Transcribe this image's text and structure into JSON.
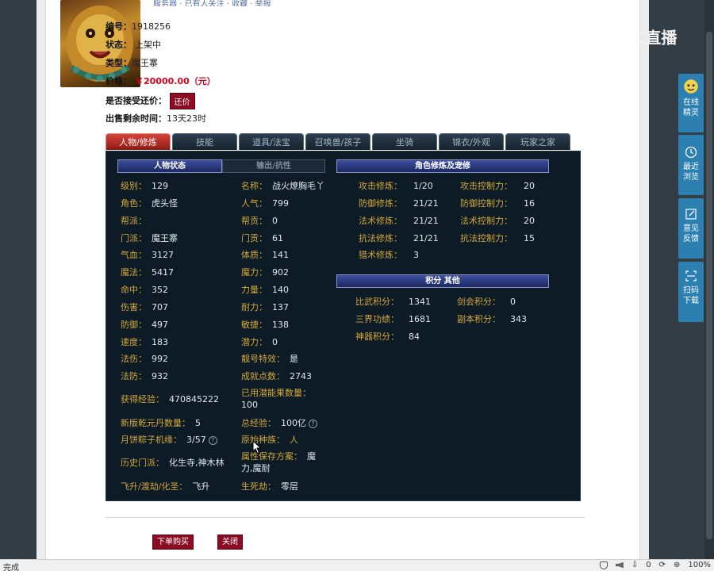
{
  "logo": "CC直播",
  "top_links": "服务器 · 已有人关注 · 收藏 · 举报",
  "info": {
    "number_label": "编号：",
    "number": "1918256",
    "status_label": "状态：",
    "status": "上架中",
    "type_label": "类型：",
    "type": "魔王寨",
    "price_label": "价格：",
    "price": "￥20000.00（元）",
    "bargain_label": "是否接受还价：",
    "bargain_button": "还价",
    "remaining_label": "出售剩余时间：",
    "remaining": "13天23时"
  },
  "tabs": [
    "人物/修炼",
    "技能",
    "道具/法宝",
    "召唤兽/孩子",
    "坐骑",
    "锦衣/外观",
    "玩家之家"
  ],
  "status_tabs": {
    "active": "人物状态",
    "inactive": "输出/抗性"
  },
  "left_col": [
    {
      "k": "级别：",
      "v": "129"
    },
    {
      "k": "角色：",
      "v": "虎头怪"
    },
    {
      "k": "帮派：",
      "v": ""
    },
    {
      "k": "门派：",
      "v": "魔王寨"
    },
    {
      "k": "气血：",
      "v": "3127"
    },
    {
      "k": "魔法：",
      "v": "5417"
    },
    {
      "k": "命中：",
      "v": "352"
    },
    {
      "k": "伤害：",
      "v": "707"
    },
    {
      "k": "防御：",
      "v": "497"
    },
    {
      "k": "速度：",
      "v": "183"
    },
    {
      "k": "法伤：",
      "v": "992"
    },
    {
      "k": "法防：",
      "v": "932"
    },
    {
      "k": "获得经验：",
      "v": "470845222"
    },
    {
      "k": "新版乾元丹数量：",
      "v": "5"
    },
    {
      "k": "月饼粽子机缘：",
      "v": "3/57"
    },
    {
      "k": "历史门派：",
      "v": "化生寺,神木林"
    },
    {
      "k": "飞升/渡劫/化圣：",
      "v": "飞升"
    }
  ],
  "mid_col": [
    {
      "k": "名称：",
      "v": "战火燎胸毛丫"
    },
    {
      "k": "人气：",
      "v": "799"
    },
    {
      "k": "帮贡：",
      "v": "0"
    },
    {
      "k": "门贡：",
      "v": "61"
    },
    {
      "k": "体质：",
      "v": "141"
    },
    {
      "k": "魔力：",
      "v": "902"
    },
    {
      "k": "力量：",
      "v": "140"
    },
    {
      "k": "耐力：",
      "v": "137"
    },
    {
      "k": "敏捷：",
      "v": "138"
    },
    {
      "k": "潜力：",
      "v": "0"
    },
    {
      "k": "靓号特效：",
      "v": "是"
    },
    {
      "k": "成就点数：",
      "v": "2743"
    },
    {
      "k": "已用潜能果数量：",
      "v": "100"
    },
    {
      "k": "总经验：",
      "v": "100亿"
    },
    {
      "k": "原始种族：",
      "v": "人"
    },
    {
      "k": "属性保存方案：",
      "v": "魔力,魔耐"
    },
    {
      "k": "生死劫：",
      "v": "零层"
    }
  ],
  "cultivation_title": "角色修炼及宠修",
  "cultivation": [
    {
      "k": "攻击修炼：",
      "v": "1/20",
      "k2": "攻击控制力：",
      "v2": "20"
    },
    {
      "k": "防御修炼：",
      "v": "21/21",
      "k2": "防御控制力：",
      "v2": "16"
    },
    {
      "k": "法术修炼：",
      "v": "21/21",
      "k2": "法术控制力：",
      "v2": "20"
    },
    {
      "k": "抗法修炼：",
      "v": "21/21",
      "k2": "抗法控制力：",
      "v2": "15"
    },
    {
      "k": "猎术修炼：",
      "v": "3",
      "k2": "",
      "v2": ""
    }
  ],
  "score_title": "积分 其他",
  "scores": [
    {
      "k": "比武积分：",
      "v": "1341",
      "k2": "剑会积分：",
      "v2": "0"
    },
    {
      "k": "三界功绩：",
      "v": "1681",
      "k2": "副本积分：",
      "v2": "343"
    },
    {
      "k": "神器积分：",
      "v": "84",
      "k2": "",
      "v2": ""
    }
  ],
  "bottom": {
    "buy": "下单购买",
    "close": "关闭"
  },
  "side_tools": [
    {
      "label": "在线精灵",
      "icon": "sprite-icon"
    },
    {
      "label": "最近浏览",
      "icon": "clock-icon"
    },
    {
      "label": "意见反馈",
      "icon": "edit-icon"
    },
    {
      "label": "扫码下载",
      "icon": "qrcode-icon"
    }
  ],
  "statusbar": {
    "left": "完成",
    "zoom": "100%",
    "count": "0"
  }
}
